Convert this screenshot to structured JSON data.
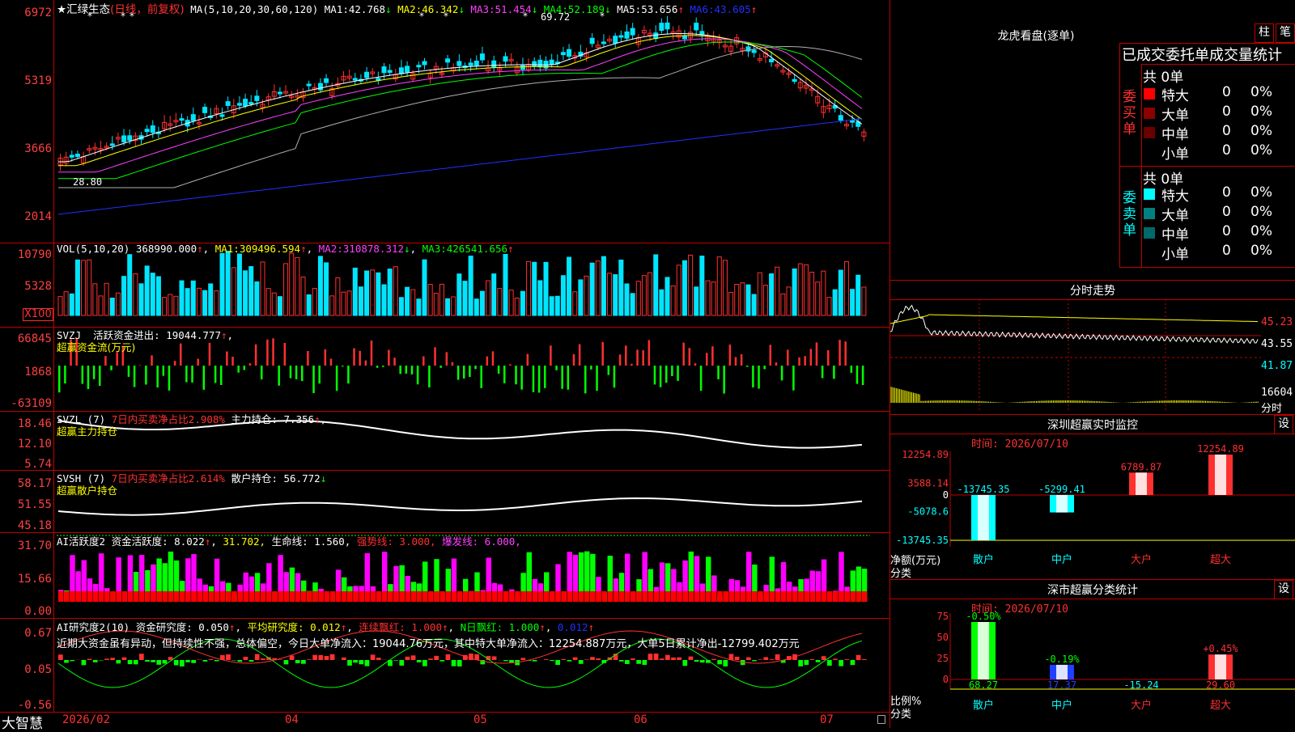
{
  "colors": {
    "up": "#ff3030",
    "down": "#00e5ff",
    "ma1": "#ffffff",
    "ma2": "#ffff00",
    "ma3": "#ff40ff",
    "ma4": "#00ff00",
    "ma5": "#b0b0b0",
    "ma6": "#2030ff",
    "grid": "#c00000",
    "green": "#00ff00",
    "magenta": "#ff00ff"
  },
  "main": {
    "title": "★汇绿生态",
    "period": "(日线，前复权)",
    "ma_label": "MA(5,10,20,30,60,120)",
    "ma": [
      {
        "label": "MA1:",
        "value": "42.768",
        "arrow": "↓",
        "color": "#ffffff"
      },
      {
        "label": "MA2:",
        "value": "46.342",
        "arrow": "↓",
        "color": "#ffff00"
      },
      {
        "label": "MA3:",
        "value": "51.454",
        "arrow": "↓",
        "color": "#ff40ff"
      },
      {
        "label": "MA4:",
        "value": "52.189",
        "arrow": "↓",
        "color": "#00ff00"
      },
      {
        "label": "MA5:",
        "value": "53.656",
        "arrow": "↑",
        "color": "#ffffff"
      },
      {
        "label": "MA6:",
        "value": "43.605",
        "arrow": "↑",
        "color": "#2030ff"
      }
    ],
    "y_ticks": [
      "6972",
      "5319",
      "3666",
      "2014"
    ],
    "high_label": "69.72",
    "low_label": "28.80",
    "markers": [
      "*",
      "*",
      "*",
      "*",
      "*",
      "*",
      "*"
    ]
  },
  "volume": {
    "header": "VOL(5,10,20)",
    "value": "368990.000",
    "ma": [
      {
        "label": "MA1:",
        "value": "309496.594",
        "arrow": "↑",
        "color": "#ffffff"
      },
      {
        "label": "MA2:",
        "value": "310878.312",
        "arrow": "↓",
        "color": "#ff40ff"
      },
      {
        "label": "MA3:",
        "value": "426541.656",
        "arrow": "↑",
        "color": "#00ff00"
      }
    ],
    "y_ticks": [
      "10790",
      "5328"
    ],
    "unit": "X100"
  },
  "svzj": {
    "header": "SVZJ",
    "label": "活跃资金进出:",
    "value": "19044.777",
    "arrow": "↑",
    "subtitle": "超赢资金流(万元)",
    "y_ticks": [
      "66845",
      "1868",
      "-63109"
    ]
  },
  "svzl": {
    "header": "SVZL (7)",
    "text1": "7日内买卖净占比2.908%",
    "text2": "主力持仓: 7.356",
    "arrow": "↑",
    "subtitle": "超赢主力持仓",
    "y_ticks": [
      "18.46",
      "12.10",
      "5.74"
    ]
  },
  "svsh": {
    "header": "SVSH (7)",
    "text1": "7日内买卖净占比2.614%",
    "text2": "散户持仓: 56.772",
    "arrow": "↓",
    "subtitle": "超赢散户持仓",
    "y_ticks": [
      "58.17",
      "51.55",
      "45.18"
    ]
  },
  "ai1": {
    "header": "AI活跃度2",
    "label": "资金活跃度:",
    "value": "8.022",
    "v2": "31.702,",
    "life": "生命线: 1.560,",
    "strong": "强势线: 3.000,",
    "burst": "爆发线: 6.000,",
    "y_ticks": [
      "31.70",
      "15.66",
      "0.00"
    ]
  },
  "ai2": {
    "header": "AI研究度2(10)",
    "label": "资金研究度:",
    "value": "0.050",
    "avg": "平均研究度: 0.012",
    "cont": "连续飘红: 1.000",
    "nday": "N日飘红: 1.000",
    "last": "0.012",
    "note": "近期大资金虽有异动，但持续性不强，总体偏空，今日大单净流入：19044.76万元，其中特大单净流入：12254.887万元，大单5日累计净出-12799.402万元",
    "y_ticks": [
      "0.67",
      "0.05",
      "-0.56"
    ]
  },
  "x_axis": {
    "brand": "大智慧",
    "labels": [
      "2026/02",
      "04",
      "05",
      "06",
      "07"
    ]
  },
  "right": {
    "lhb_title": "龙虎看盘(逐单)",
    "btn_zhu": "柱",
    "btn_bi": "笔",
    "table_title": "已成交委托单成交量统计",
    "buy_label": "委买单",
    "sell_label": "委卖单",
    "buy_total": "共 0单",
    "sell_total": "共 0单",
    "buy_rows": [
      {
        "name": "特大",
        "count": "0",
        "pct": "0%",
        "color": "#ff0000"
      },
      {
        "name": "大单",
        "count": "0",
        "pct": "0%",
        "color": "#8b0000"
      },
      {
        "name": "中单",
        "count": "0",
        "pct": "0%",
        "color": "#6a0000"
      },
      {
        "name": "小单",
        "count": "0",
        "pct": "0%",
        "color": ""
      }
    ],
    "sell_rows": [
      {
        "name": "特大",
        "count": "0",
        "pct": "0%",
        "color": "#00ffff"
      },
      {
        "name": "大单",
        "count": "0",
        "pct": "0%",
        "color": "#008080"
      },
      {
        "name": "中单",
        "count": "0",
        "pct": "0%",
        "color": "#006a6a"
      },
      {
        "name": "小单",
        "count": "0",
        "pct": "0%",
        "color": ""
      }
    ],
    "intraday_title": "分时走势",
    "intraday_ticks": [
      "45.23",
      "43.55",
      "41.87"
    ],
    "intraday_vol": "16604",
    "intraday_unit": "分时",
    "sz_title": "深圳超赢实时监控",
    "sz_btn": "设",
    "sz_time": "时间: 2026/07/10",
    "sz_yticks": [
      "12254.89",
      "3588.14",
      "0",
      "-5078.6",
      "-13745.35"
    ],
    "sz_ylabel": "净额(万元)",
    "sz_xlabel": "分类",
    "cls_title": "深市超赢分类统计",
    "cls_btn": "设",
    "cls_time": "时间: 2026/07/10",
    "cls_yticks": [
      "75",
      "50",
      "25",
      "0"
    ],
    "cls_ylabel": "比例%",
    "cls_xlabel": "分类"
  },
  "chart_data": [
    {
      "type": "bar",
      "title": "深圳超赢实时监控",
      "ylabel": "净额(万元)",
      "xlabel": "分类",
      "categories": [
        "散户",
        "中户",
        "大户",
        "超大"
      ],
      "values": [
        -13745.35,
        -5299.41,
        6789.87,
        12254.89
      ],
      "value_labels": [
        "-13745.35",
        "-5299.41",
        "6789.87",
        "12254.89"
      ],
      "ylim": [
        -13745.35,
        12254.89
      ]
    },
    {
      "type": "bar",
      "title": "深市超赢分类统计",
      "ylabel": "比例%",
      "xlabel": "分类",
      "categories": [
        "散户",
        "中户",
        "大户",
        "超大"
      ],
      "values": [
        68.27,
        17.37,
        -15.24,
        29.6
      ],
      "change_labels": [
        "-0.50%",
        "-0.19%",
        "",
        "+0.45%"
      ],
      "ylim": [
        0,
        75
      ]
    }
  ]
}
